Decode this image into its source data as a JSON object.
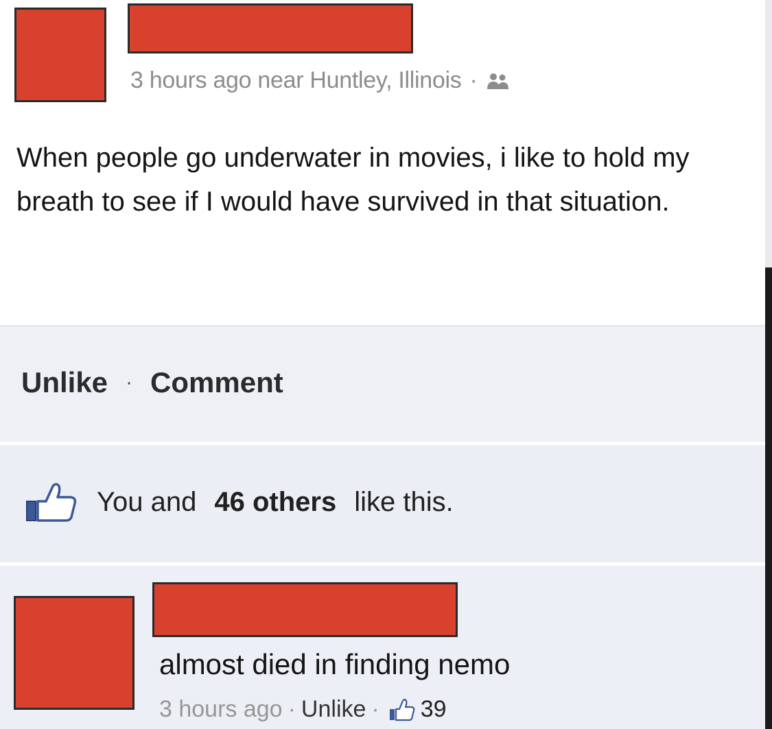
{
  "post": {
    "meta_time": "3 hours ago near Huntley, Illinois",
    "meta_separator": "·",
    "privacy_icon": "friends-icon",
    "text": "When people go underwater in movies, i like to hold my breath to see if I would have survived in that situation."
  },
  "actions": {
    "unlike_label": "Unlike",
    "separator": "·",
    "comment_label": "Comment"
  },
  "likes": {
    "icon": "thumbs-up-icon",
    "you_and": "You and",
    "others": "46 others",
    "like_this": "like this."
  },
  "comment": {
    "text": "almost died in finding nemo",
    "time": "3 hours ago",
    "separator1": "·",
    "unlike_label": "Unlike",
    "separator2": "·",
    "like_icon": "thumbs-up-icon",
    "like_count": "39"
  },
  "colors": {
    "redaction": "#d9412f",
    "action_bg": "#eef0f6",
    "meta_text": "#8c8c8c"
  }
}
